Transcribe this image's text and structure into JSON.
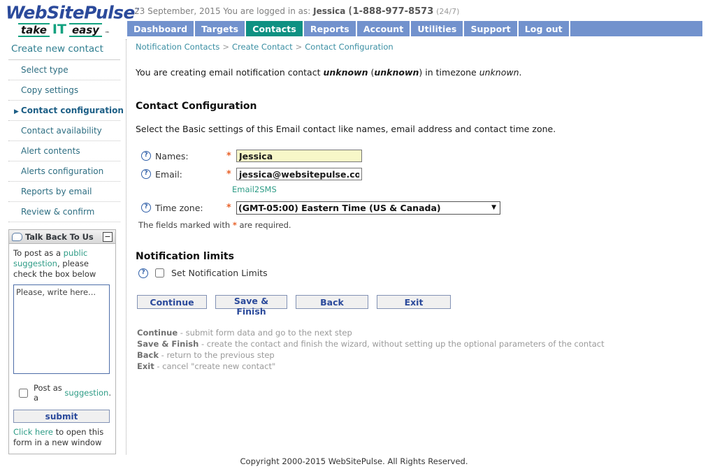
{
  "brand": {
    "name": "WebSitePulse",
    "tm": "™",
    "tagline_take": "take",
    "tagline_it": "IT",
    "tagline_easy": "easy",
    "tagline_tm": "™"
  },
  "header": {
    "date": "23 September, 2015",
    "logged_in_prefix": "You are logged in as:",
    "user_name": "Jessica",
    "phone_icon": "phone-icon",
    "phone": "1-888-977-8573",
    "phone_note": "(24/7)"
  },
  "nav": {
    "items": [
      {
        "label": "Dashboard",
        "active": false
      },
      {
        "label": "Targets",
        "active": false
      },
      {
        "label": "Contacts",
        "active": true
      },
      {
        "label": "Reports",
        "active": false
      },
      {
        "label": "Account",
        "active": false
      },
      {
        "label": "Utilities",
        "active": false
      },
      {
        "label": "Support",
        "active": false
      },
      {
        "label": "Log out",
        "active": false
      }
    ],
    "active_color": "#0e9182",
    "bar_color": "#7292cd"
  },
  "sidebar": {
    "title": "Create new contact",
    "items": [
      {
        "label": "Select type",
        "current": false
      },
      {
        "label": "Copy settings",
        "current": false
      },
      {
        "label": "Contact configuration",
        "current": true,
        "marker": "▶"
      },
      {
        "label": "Contact availability",
        "current": false
      },
      {
        "label": "Alert contents",
        "current": false
      },
      {
        "label": "Alerts configuration",
        "current": false
      },
      {
        "label": "Reports by email",
        "current": false
      },
      {
        "label": "Review & confirm",
        "current": false
      }
    ]
  },
  "talkback": {
    "title": "Talk Back To Us",
    "minimize_label": "−",
    "intro_pre": "To post as a ",
    "intro_link": "public suggestion",
    "intro_post": ", please check the box below",
    "textarea_value": "Please, write here...",
    "checkbox_pre": "Post as a ",
    "checkbox_link": "suggestion",
    "checkbox_post": ".",
    "checkbox_checked": false,
    "submit_label": "submit",
    "footer_link": "Click here",
    "footer_text": " to open this form in a new window"
  },
  "breadcrumb": {
    "items": [
      "Notification Contacts",
      "Create Contact",
      "Contact Configuration"
    ],
    "separator": ">"
  },
  "main": {
    "intro_pre": "You are creating email notification contact ",
    "intro_name": "unknown",
    "intro_paren_open": " (",
    "intro_alias": "unknown",
    "intro_paren_close": ")",
    "intro_mid": " in timezone ",
    "intro_timezone": "unknown",
    "intro_end": ".",
    "section_title": "Contact Configuration",
    "section_desc": "Select the Basic settings of this Email contact like names, email address and contact time zone.",
    "fields": {
      "names": {
        "label": "Names:",
        "required_mark": "*",
        "value": "Jessica",
        "help_icon": "question-mark-icon"
      },
      "email": {
        "label": "Email:",
        "required_mark": "*",
        "value": "jessica@websitepulse.com",
        "help_icon": "question-mark-icon",
        "sub_link": "Email2SMS"
      },
      "timezone": {
        "label": "Time zone:",
        "required_mark": "*",
        "value": "(GMT-05:00) Eastern Time (US & Canada)",
        "help_icon": "question-mark-icon",
        "options": [
          "(GMT-05:00) Eastern Time (US & Canada)"
        ],
        "arrow_icon": "chevron-down-icon"
      }
    },
    "required_note_pre": "The fields marked with ",
    "required_note_star": "*",
    "required_note_post": " are required.",
    "notification_limits": {
      "title": "Notification limits",
      "checkbox_label": "Set Notification Limits",
      "checked": false,
      "help_icon": "question-mark-icon"
    },
    "buttons": [
      {
        "label": "Continue",
        "name": "continue-button"
      },
      {
        "label": "Save & Finish",
        "name": "save-finish-button"
      },
      {
        "label": "Back",
        "name": "back-button"
      },
      {
        "label": "Exit",
        "name": "exit-button"
      }
    ],
    "legend": [
      {
        "term": "Continue",
        "desc": " - submit form data and go to the next step"
      },
      {
        "term": "Save & Finish",
        "desc": " - create the contact and finish the wizard, without setting up the optional parameters of the contact"
      },
      {
        "term": "Back",
        "desc": " - return to the previous step"
      },
      {
        "term": "Exit",
        "desc": " - cancel \"create new contact\""
      }
    ]
  },
  "footer": {
    "copyright": "Copyright 2000-2015 WebSitePulse. All Rights Reserved."
  }
}
